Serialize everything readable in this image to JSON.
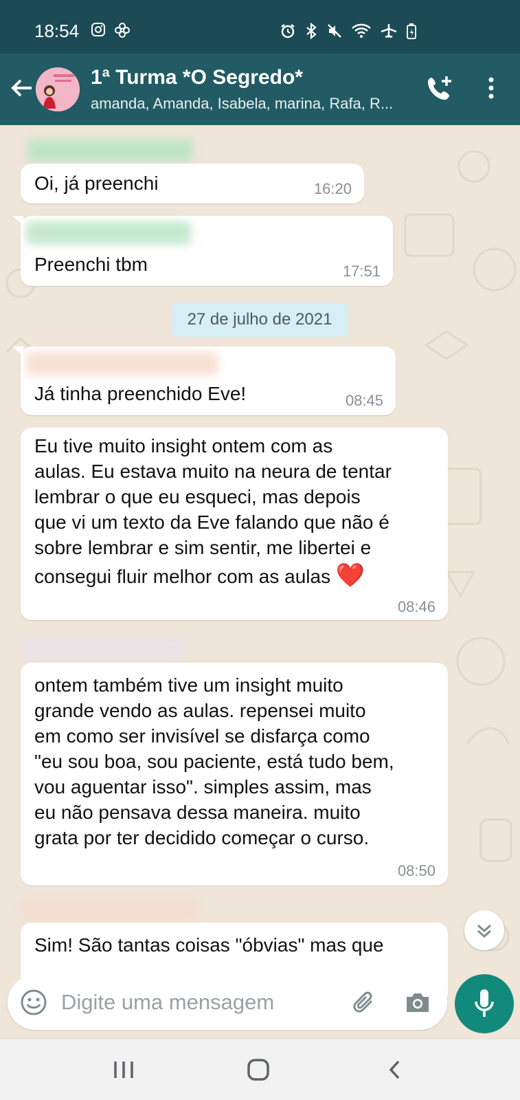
{
  "status_bar": {
    "time": "18:54",
    "left_icons": [
      "instagram-icon",
      "pinwheel-icon"
    ],
    "right_icons": [
      "alarm-icon",
      "bluetooth-icon",
      "mute-icon",
      "wifi-icon",
      "airplane-icon",
      "battery-icon"
    ]
  },
  "header": {
    "title": "1ª Turma *O Segredo*",
    "members": "amanda, Amanda, Isabela, marina, Rafa, R..."
  },
  "messages": [
    {
      "text": "Oi, já preenchi",
      "time": "16:20"
    },
    {
      "text": "Preenchi tbm",
      "time": "17:51"
    },
    {
      "text": "Já tinha preenchido Eve!",
      "time": "08:45"
    },
    {
      "lines": [
        "Eu tive muito insight ontem com as",
        "aulas. Eu estava muito na neura de tentar",
        "lembrar o que eu esqueci, mas depois",
        "que vi um texto da Eve falando que não é",
        "sobre lembrar e sim sentir, me libertei e",
        "consegui fluir melhor com as aulas"
      ],
      "emoji": "❤️",
      "time": "08:46"
    },
    {
      "lines": [
        "ontem também tive um insight muito",
        "grande vendo as aulas. repensei muito",
        "em como ser invisível se disfarça como",
        "\"eu sou boa, sou paciente, está tudo bem,",
        "vou aguentar isso\". simples assim, mas",
        "eu não pensava dessa maneira. muito",
        "grata por ter decidido começar o curso."
      ],
      "time": "08:50"
    },
    {
      "text": "Sim! São tantas coisas \"óbvias\" mas que"
    }
  ],
  "date_divider": "27 de julho de 2021",
  "composer": {
    "placeholder": "Digite uma mensagem"
  },
  "colors": {
    "status_bar": "#1c4b55",
    "app_bar": "#225b64",
    "chat_background": "#efe5d8",
    "bubble": "#ffffff",
    "date_chip": "#d6eef5",
    "mic_button": "#128a7b"
  }
}
